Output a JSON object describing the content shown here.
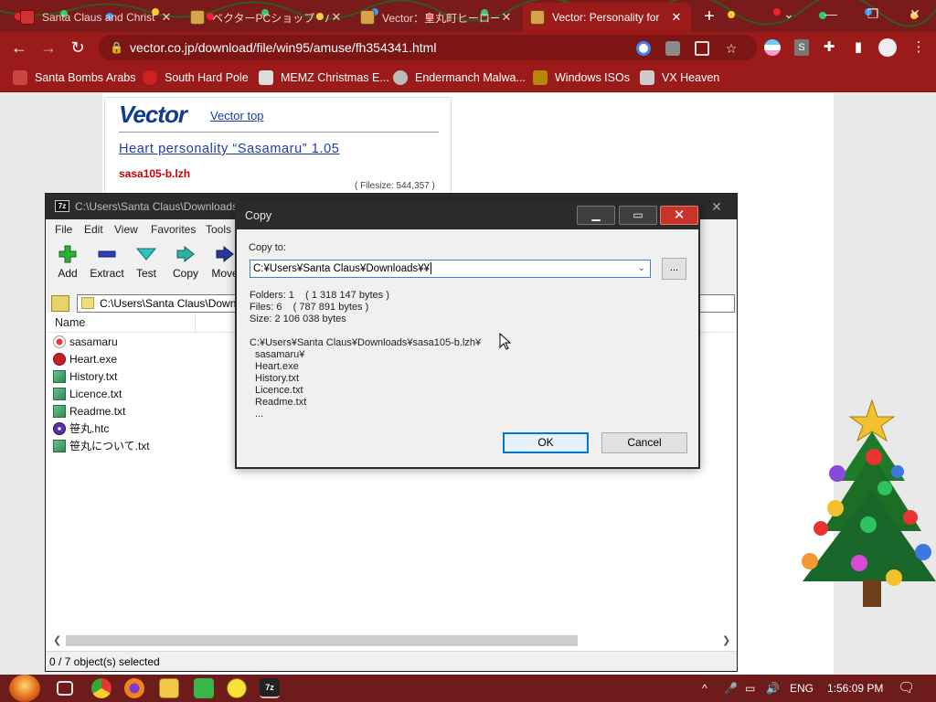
{
  "browser": {
    "tabs": [
      {
        "title": "Santa Claus and Christ",
        "active": false
      },
      {
        "title": "ベクターPCショップ - パソコ",
        "active": false
      },
      {
        "title": "Vector：皇丸町ヒーロー",
        "active": false
      },
      {
        "title": "Vector: Personality for",
        "active": true
      }
    ],
    "new_tab": "+",
    "window_controls": {
      "collapse": "⌄",
      "minimize": "—",
      "restore": "❐",
      "close": "✕"
    },
    "url": "vector.co.jp/download/file/win95/amuse/fh354341.html",
    "bookmarks": [
      "Santa Bombs Arabs",
      "South Hard Pole",
      "MEMZ Christmas E...",
      "Endermanch Malwa...",
      "Windows ISOs",
      "VX Heaven"
    ],
    "profile_letter": "S",
    "colors": {
      "tabbar": "#7a1a1a",
      "toolbar": "#9b1b1b"
    }
  },
  "vector_page": {
    "logo": "Vector",
    "top_link": "Vector top",
    "title_link": "Heart personality “Sasamaru” 1.05",
    "filename": "sasa105-b.lzh",
    "filesize": "( Filesize: 544,357 )"
  },
  "zip": {
    "title": "C:\\Users\\Santa Claus\\Downloads",
    "menu": [
      "File",
      "Edit",
      "View",
      "Favorites",
      "Tools"
    ],
    "toolbar": [
      {
        "label": "Add",
        "icon": "add-icon"
      },
      {
        "label": "Extract",
        "icon": "extract-icon"
      },
      {
        "label": "Test",
        "icon": "test-icon"
      },
      {
        "label": "Copy",
        "icon": "copy-icon"
      },
      {
        "label": "Move",
        "icon": "move-icon"
      }
    ],
    "path": "C:\\Users\\Santa Claus\\Down",
    "column_name": "Name",
    "files": [
      {
        "name": "sasamaru",
        "icon": "folder-heart-icon"
      },
      {
        "name": "Heart.exe",
        "icon": "exe-heart-icon"
      },
      {
        "name": "History.txt",
        "icon": "text-file-icon"
      },
      {
        "name": "Licence.txt",
        "icon": "text-file-icon"
      },
      {
        "name": "Readme.txt",
        "icon": "text-file-icon"
      },
      {
        "name": "笹丸.htc",
        "icon": "htc-file-icon"
      },
      {
        "name": "笹丸について.txt",
        "icon": "text-file-icon"
      }
    ],
    "status": "0 / 7 object(s) selected"
  },
  "copy_dialog": {
    "title": "Copy",
    "copy_to_label": "Copy to:",
    "destination": "C:¥Users¥Santa Claus¥Downloads¥¥",
    "browse_label": "...",
    "folders": "Folders: 1    ( 1 318 147 bytes )",
    "files": "Files: 6    ( 787 891 bytes )",
    "size": "Size: 2 106 038 bytes",
    "source": "C:¥Users¥Santa Claus¥Downloads¥sasa105-b.lzh¥",
    "items": [
      "sasamaru¥",
      "Heart.exe",
      "History.txt",
      "Licence.txt",
      "Readme.txt",
      "..."
    ],
    "ok_label": "OK",
    "cancel_label": "Cancel"
  },
  "taskbar": {
    "language": "ENG",
    "clock": "1:56:09 PM",
    "apps": [
      "start-icon",
      "task-view-icon",
      "chrome-icon",
      "firefox-icon",
      "explorer-icon",
      "notepad-icon",
      "smiley-icon",
      "7zip-icon"
    ]
  }
}
